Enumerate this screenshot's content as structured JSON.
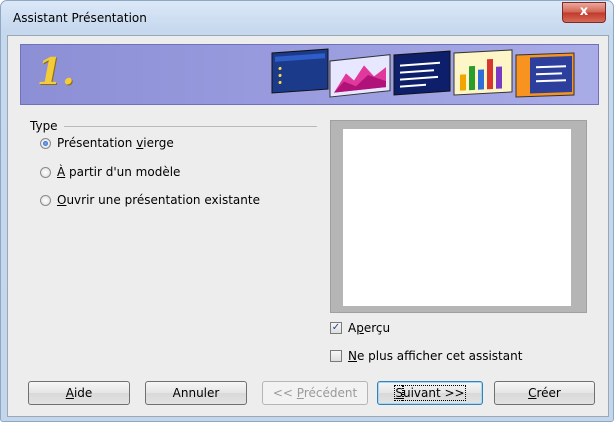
{
  "window": {
    "title": "Assistant Présentation",
    "close_glyph": "x"
  },
  "banner": {
    "step": "1."
  },
  "type_group": {
    "label": "Type",
    "options": [
      {
        "label_pre": "Présentation ",
        "label_ul": "v",
        "label_post": "ierge",
        "checked": true
      },
      {
        "label_pre": "",
        "label_ul": "À",
        "label_post": " partir d'un modèle",
        "checked": false
      },
      {
        "label_pre": "",
        "label_ul": "O",
        "label_post": "uvrir une présentation existante",
        "checked": false
      }
    ]
  },
  "preview": {
    "apercu_ul": "p",
    "apercu_pre": "A",
    "apercu_post": "erçu",
    "apercu_checked": true,
    "no_show_ul": "N",
    "no_show_post": "e plus afficher cet assistant",
    "no_show_checked": false
  },
  "buttons": {
    "help_ul": "A",
    "help_post": "ide",
    "cancel": "Annuler",
    "prev_pre": "<< ",
    "prev_ul": "P",
    "prev_post": "récédent",
    "next_ul": "S",
    "next_post": "uivant >>",
    "create_ul": "C",
    "create_post": "réer"
  },
  "colors": {
    "banner": "#9c9fe0",
    "step_number": "#f4cc38",
    "focus_border": "#3c7fb1"
  }
}
